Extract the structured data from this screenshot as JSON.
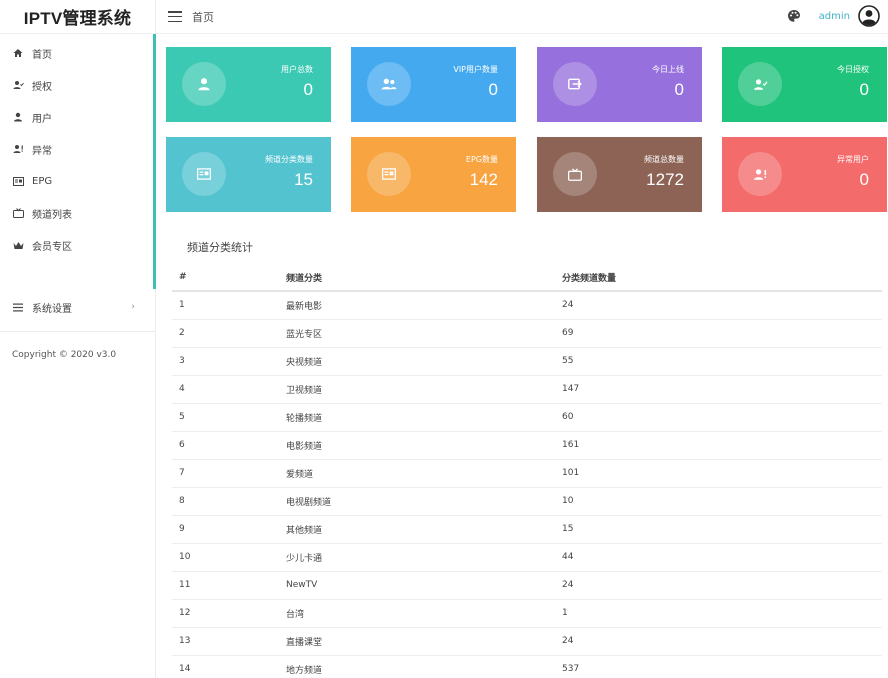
{
  "app": {
    "title": "IPTV管理系统"
  },
  "topbar": {
    "breadcrumb": "首页",
    "user": "admin"
  },
  "sidebar": {
    "items": [
      {
        "label": "首页",
        "icon": "home-icon"
      },
      {
        "label": "授权",
        "icon": "user-check-icon"
      },
      {
        "label": "用户",
        "icon": "user-icon"
      },
      {
        "label": "异常",
        "icon": "user-alert-icon"
      },
      {
        "label": "EPG",
        "icon": "epg-icon"
      },
      {
        "label": "频道列表",
        "icon": "tv-icon"
      },
      {
        "label": "会员专区",
        "icon": "crown-icon"
      },
      {
        "label": "系统设置",
        "icon": "menu-icon",
        "arrow": "›"
      }
    ],
    "copyright": "Copyright © 2020 v3.0"
  },
  "cards": [
    {
      "label": "用户总数",
      "value": "0",
      "color": "#3cc9b4",
      "icon": "user-icon"
    },
    {
      "label": "VIP用户数量",
      "value": "0",
      "color": "#45a9f0",
      "icon": "users-icon"
    },
    {
      "label": "今日上线",
      "value": "0",
      "color": "#9670dc",
      "icon": "login-icon"
    },
    {
      "label": "今日授权",
      "value": "0",
      "color": "#1fc37b",
      "icon": "user-check-icon"
    },
    {
      "label": "频道分类数量",
      "value": "15",
      "color": "#53c3d0",
      "icon": "epg-icon"
    },
    {
      "label": "EPG数量",
      "value": "142",
      "color": "#f7a441",
      "icon": "epg-icon"
    },
    {
      "label": "频道总数量",
      "value": "1272",
      "color": "#8c6355",
      "icon": "tv-icon"
    },
    {
      "label": "异常用户",
      "value": "0",
      "color": "#f46b6b",
      "icon": "user-alert-icon"
    }
  ],
  "table": {
    "title": "频道分类统计",
    "headers": [
      "#",
      "频道分类",
      "分类频道数量"
    ],
    "rows": [
      [
        "1",
        "最新电影",
        "24"
      ],
      [
        "2",
        "蓝光专区",
        "69"
      ],
      [
        "3",
        "央视频道",
        "55"
      ],
      [
        "4",
        "卫视频道",
        "147"
      ],
      [
        "5",
        "轮播频道",
        "60"
      ],
      [
        "6",
        "电影频道",
        "161"
      ],
      [
        "7",
        "爱频道",
        "101"
      ],
      [
        "8",
        "电视剧频道",
        "10"
      ],
      [
        "9",
        "其他频道",
        "15"
      ],
      [
        "10",
        "少儿卡通",
        "44"
      ],
      [
        "11",
        "NewTV",
        "24"
      ],
      [
        "12",
        "台湾",
        "1"
      ],
      [
        "13",
        "直播课堂",
        "24"
      ],
      [
        "14",
        "地方频道",
        "537"
      ]
    ]
  }
}
